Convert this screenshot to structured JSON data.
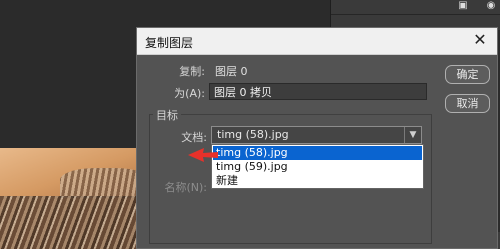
{
  "dialog": {
    "title": "复制图层",
    "source_label": "复制:",
    "source_value": "图层 0",
    "as_label": "为(A):",
    "as_value": "图层 0 拷贝",
    "destination_group": "目标",
    "document_label": "文档:",
    "document_value": "timg (58).jpg",
    "document_options": [
      "timg (58).jpg",
      "timg (59).jpg",
      "新建"
    ],
    "name_label": "名称(N):",
    "ok_label": "确定",
    "cancel_label": "取消"
  },
  "colors": {
    "dialog_bg": "#535353",
    "titlebar_bg": "#f0f0f0",
    "highlight": "#0a64d0",
    "arrow": "#e8312a"
  },
  "icons": [
    "close-icon",
    "chevron-down-icon",
    "red-arrow-icon"
  ]
}
